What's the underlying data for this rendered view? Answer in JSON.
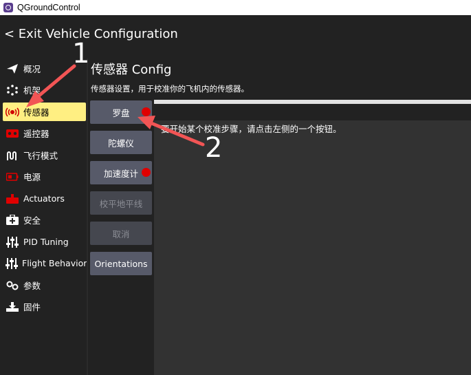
{
  "window": {
    "title": "QGroundControl",
    "icon": "qgc-app-icon"
  },
  "header": {
    "exit_label": "< Exit Vehicle Configuration"
  },
  "sidebar": {
    "items": [
      {
        "label": "概况",
        "icon": "paper-plane-icon",
        "active": false
      },
      {
        "label": "机架",
        "icon": "airframe-icon",
        "active": false
      },
      {
        "label": "传感器",
        "icon": "sensors-icon",
        "active": true
      },
      {
        "label": "遥控器",
        "icon": "radio-controller-icon",
        "active": false
      },
      {
        "label": "飞行模式",
        "icon": "flight-modes-icon",
        "active": false
      },
      {
        "label": "电源",
        "icon": "battery-icon",
        "active": false
      },
      {
        "label": "Actuators",
        "icon": "actuators-icon",
        "active": false
      },
      {
        "label": "安全",
        "icon": "safety-icon",
        "active": false
      },
      {
        "label": "PID Tuning",
        "icon": "sliders-icon",
        "active": false
      },
      {
        "label": "Flight Behavior",
        "icon": "sliders-icon",
        "active": false
      },
      {
        "label": "参数",
        "icon": "parameters-icon",
        "active": false
      },
      {
        "label": "固件",
        "icon": "firmware-icon",
        "active": false
      }
    ]
  },
  "main": {
    "title": "传感器 Config",
    "description": "传感器设置，用于校准你的飞机内的传感器。",
    "buttons": [
      {
        "label": "罗盘",
        "needs_calibration": true,
        "enabled": true
      },
      {
        "label": "陀螺仪",
        "needs_calibration": false,
        "enabled": true
      },
      {
        "label": "加速度计",
        "needs_calibration": true,
        "enabled": true
      },
      {
        "label": "校平地平线",
        "needs_calibration": false,
        "enabled": false
      },
      {
        "label": "取消",
        "needs_calibration": false,
        "enabled": false
      },
      {
        "label": "Orientations",
        "needs_calibration": false,
        "enabled": true
      }
    ],
    "instruction": "要开始某个校准步骤，请点击左侧的一个按钮。"
  },
  "annotations": {
    "step1": "1",
    "step2": "2",
    "arrow_color": "#f25555"
  },
  "colors": {
    "active_highlight": "#ffef82",
    "calibration_dot": "#e00000",
    "button_bg": "#575a69"
  }
}
